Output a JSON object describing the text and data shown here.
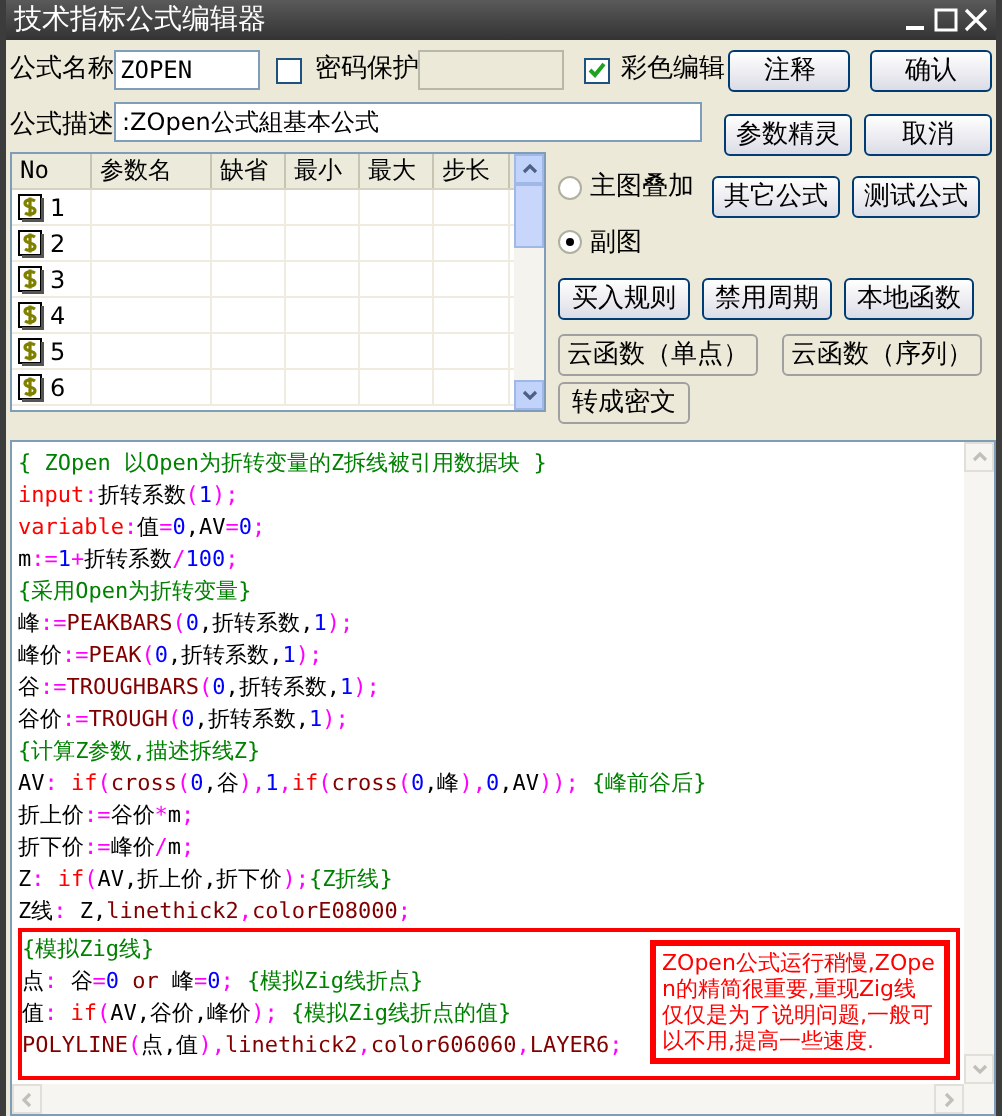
{
  "window": {
    "title": "技术指标公式编辑器"
  },
  "name_row": {
    "label": "公式名称",
    "value": "ZOPEN",
    "password": {
      "label": "密码保护",
      "checked": false
    },
    "color_edit": {
      "label": "彩色编辑",
      "checked": true
    }
  },
  "desc_row": {
    "label": "公式描述",
    "value": ":ZOpen公式組基本公式"
  },
  "top_buttons": [
    "注释",
    "确认",
    "参数精灵",
    "取消"
  ],
  "table": {
    "columns": [
      "No",
      "参数名",
      "缺省",
      "最小",
      "最大",
      "步长"
    ],
    "rows": [
      {
        "no": "1"
      },
      {
        "no": "2"
      },
      {
        "no": "3"
      },
      {
        "no": "4"
      },
      {
        "no": "5"
      },
      {
        "no": "6"
      }
    ]
  },
  "radios": [
    {
      "label": "主图叠加",
      "selected": false
    },
    {
      "label": "副图",
      "selected": true
    }
  ],
  "side_buttons": [
    {
      "label": "其它公式",
      "kind": "raised"
    },
    {
      "label": "测试公式",
      "kind": "raised"
    },
    {
      "label": "买入规则",
      "kind": "raised"
    },
    {
      "label": "禁用周期",
      "kind": "raised"
    },
    {
      "label": "本地函数",
      "kind": "raised"
    },
    {
      "label": "云函数（单点）",
      "kind": "flat"
    },
    {
      "label": "云函数（序列）",
      "kind": "flat"
    },
    {
      "label": "转成密文",
      "kind": "flat"
    }
  ],
  "code": {
    "lines": [
      [
        {
          "kind": "comment",
          "text": "{ ZOpen 以Open为折转变量的Z拆线被引用数据块 }"
        }
      ],
      [
        {
          "kind": "keyword",
          "text": "input"
        },
        {
          "kind": "op",
          "text": ":"
        },
        {
          "kind": "ident",
          "text": "折转系数"
        },
        {
          "kind": "op",
          "text": "("
        },
        {
          "kind": "num",
          "text": "1"
        },
        {
          "kind": "op",
          "text": ");"
        }
      ],
      [
        {
          "kind": "keyword",
          "text": "variable"
        },
        {
          "kind": "op",
          "text": ":"
        },
        {
          "kind": "ident",
          "text": "值"
        },
        {
          "kind": "op",
          "text": "="
        },
        {
          "kind": "num",
          "text": "0"
        },
        {
          "kind": "ident",
          "text": ",AV"
        },
        {
          "kind": "op",
          "text": "="
        },
        {
          "kind": "num",
          "text": "0"
        },
        {
          "kind": "op",
          "text": ";"
        }
      ],
      [
        {
          "kind": "ident",
          "text": "m"
        },
        {
          "kind": "op",
          "text": ":="
        },
        {
          "kind": "num",
          "text": "1"
        },
        {
          "kind": "op",
          "text": "+"
        },
        {
          "kind": "ident",
          "text": "折转系数"
        },
        {
          "kind": "op",
          "text": "/"
        },
        {
          "kind": "num",
          "text": "100"
        },
        {
          "kind": "op",
          "text": ";"
        }
      ],
      [
        {
          "kind": "comment",
          "text": "{采用Open为折转变量}"
        }
      ],
      [
        {
          "kind": "ident",
          "text": "峰"
        },
        {
          "kind": "op",
          "text": ":="
        },
        {
          "kind": "func",
          "text": "PEAKBARS"
        },
        {
          "kind": "op",
          "text": "("
        },
        {
          "kind": "num",
          "text": "0"
        },
        {
          "kind": "ident",
          "text": ",折转系数,"
        },
        {
          "kind": "num",
          "text": "1"
        },
        {
          "kind": "op",
          "text": ");"
        }
      ],
      [
        {
          "kind": "ident",
          "text": "峰价"
        },
        {
          "kind": "op",
          "text": ":="
        },
        {
          "kind": "func",
          "text": "PEAK"
        },
        {
          "kind": "op",
          "text": "("
        },
        {
          "kind": "num",
          "text": "0"
        },
        {
          "kind": "ident",
          "text": ",折转系数,"
        },
        {
          "kind": "num",
          "text": "1"
        },
        {
          "kind": "op",
          "text": ");"
        }
      ],
      [
        {
          "kind": "ident",
          "text": "谷"
        },
        {
          "kind": "op",
          "text": ":="
        },
        {
          "kind": "func",
          "text": "TROUGHBARS"
        },
        {
          "kind": "op",
          "text": "("
        },
        {
          "kind": "num",
          "text": "0"
        },
        {
          "kind": "ident",
          "text": ",折转系数,"
        },
        {
          "kind": "num",
          "text": "1"
        },
        {
          "kind": "op",
          "text": ");"
        }
      ],
      [
        {
          "kind": "ident",
          "text": "谷价"
        },
        {
          "kind": "op",
          "text": ":="
        },
        {
          "kind": "func",
          "text": "TROUGH"
        },
        {
          "kind": "op",
          "text": "("
        },
        {
          "kind": "num",
          "text": "0"
        },
        {
          "kind": "ident",
          "text": ",折转系数,"
        },
        {
          "kind": "num",
          "text": "1"
        },
        {
          "kind": "op",
          "text": ");"
        }
      ],
      [
        {
          "kind": "comment",
          "text": "{计算Z参数,描述拆线Z}"
        }
      ],
      [
        {
          "kind": "ident",
          "text": "AV"
        },
        {
          "kind": "op",
          "text": ": "
        },
        {
          "kind": "keyword",
          "text": "if"
        },
        {
          "kind": "op",
          "text": "("
        },
        {
          "kind": "func",
          "text": "cross"
        },
        {
          "kind": "op",
          "text": "("
        },
        {
          "kind": "num",
          "text": "0"
        },
        {
          "kind": "ident",
          "text": ",谷"
        },
        {
          "kind": "op",
          "text": "),"
        },
        {
          "kind": "num",
          "text": "1"
        },
        {
          "kind": "op",
          "text": ","
        },
        {
          "kind": "keyword",
          "text": "if"
        },
        {
          "kind": "op",
          "text": "("
        },
        {
          "kind": "func",
          "text": "cross"
        },
        {
          "kind": "op",
          "text": "("
        },
        {
          "kind": "num",
          "text": "0"
        },
        {
          "kind": "ident",
          "text": ",峰"
        },
        {
          "kind": "op",
          "text": "),"
        },
        {
          "kind": "num",
          "text": "0"
        },
        {
          "kind": "ident",
          "text": ",AV"
        },
        {
          "kind": "op",
          "text": ")); "
        },
        {
          "kind": "comment",
          "text": "{峰前谷后}"
        }
      ],
      [
        {
          "kind": "ident",
          "text": "折上价"
        },
        {
          "kind": "op",
          "text": ":="
        },
        {
          "kind": "ident",
          "text": "谷价"
        },
        {
          "kind": "op",
          "text": "*"
        },
        {
          "kind": "ident",
          "text": "m"
        },
        {
          "kind": "op",
          "text": ";"
        }
      ],
      [
        {
          "kind": "ident",
          "text": "折下价"
        },
        {
          "kind": "op",
          "text": ":="
        },
        {
          "kind": "ident",
          "text": "峰价"
        },
        {
          "kind": "op",
          "text": "/"
        },
        {
          "kind": "ident",
          "text": "m"
        },
        {
          "kind": "op",
          "text": ";"
        }
      ],
      [
        {
          "kind": "ident",
          "text": "Z"
        },
        {
          "kind": "op",
          "text": ": "
        },
        {
          "kind": "keyword",
          "text": "if"
        },
        {
          "kind": "op",
          "text": "("
        },
        {
          "kind": "ident",
          "text": "AV,折上价,折下价"
        },
        {
          "kind": "op",
          "text": ");"
        },
        {
          "kind": "comment",
          "text": "{Z折线}"
        }
      ],
      [
        {
          "kind": "ident",
          "text": "Z线"
        },
        {
          "kind": "op",
          "text": ": "
        },
        {
          "kind": "ident",
          "text": "Z,"
        },
        {
          "kind": "func",
          "text": "linethick2"
        },
        {
          "kind": "op",
          "text": ","
        },
        {
          "kind": "func",
          "text": "colorE08000"
        },
        {
          "kind": "op",
          "text": ";"
        }
      ]
    ],
    "marked_block": {
      "lines": [
        [
          {
            "kind": "comment",
            "text": "{模拟Zig线}"
          }
        ],
        [
          {
            "kind": "ident",
            "text": "点"
          },
          {
            "kind": "op",
            "text": ": "
          },
          {
            "kind": "ident",
            "text": "谷"
          },
          {
            "kind": "op",
            "text": "="
          },
          {
            "kind": "num",
            "text": "0"
          },
          {
            "kind": "func",
            "text": " or "
          },
          {
            "kind": "ident",
            "text": "峰"
          },
          {
            "kind": "op",
            "text": "="
          },
          {
            "kind": "num",
            "text": "0"
          },
          {
            "kind": "op",
            "text": "; "
          },
          {
            "kind": "comment",
            "text": "{模拟Zig线折点}"
          }
        ],
        [
          {
            "kind": "ident",
            "text": "值"
          },
          {
            "kind": "op",
            "text": ": "
          },
          {
            "kind": "keyword",
            "text": "if"
          },
          {
            "kind": "op",
            "text": "("
          },
          {
            "kind": "ident",
            "text": "AV,谷价,峰价"
          },
          {
            "kind": "op",
            "text": "); "
          },
          {
            "kind": "comment",
            "text": "{模拟Zig线折点的值}"
          }
        ],
        [
          {
            "kind": "func",
            "text": "POLYLINE"
          },
          {
            "kind": "op",
            "text": "("
          },
          {
            "kind": "ident",
            "text": "点,值"
          },
          {
            "kind": "op",
            "text": "),"
          },
          {
            "kind": "func",
            "text": "linethick2"
          },
          {
            "kind": "op",
            "text": ","
          },
          {
            "kind": "func",
            "text": "color606060"
          },
          {
            "kind": "op",
            "text": ","
          },
          {
            "kind": "func",
            "text": "LAYER6"
          },
          {
            "kind": "op",
            "text": ";"
          }
        ]
      ],
      "note": "ZOpen公式运行稍慢,ZOpen的精简很重要,重现Zig线仅仅是为了说明问题,一般可以不用,提高一些速度."
    }
  }
}
